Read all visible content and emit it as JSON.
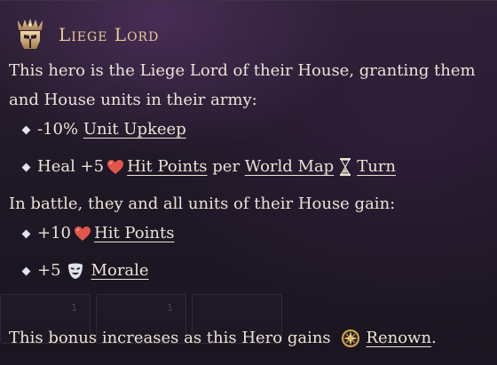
{
  "tooltip": {
    "title": "Liege Lord",
    "description_line1": "This hero is the Liege Lord of their House, granting them",
    "description_line2": "and House units in their army:",
    "bonuses_army": [
      {
        "prefix": "-10%",
        "link": "Unit Upkeep"
      },
      {
        "prefix": "Heal +5",
        "link1": "Hit Points",
        "per": "per",
        "link2": "World Map",
        "link3": "Turn"
      }
    ],
    "battle_intro": "In battle, they and all units of their House gain:",
    "bonuses_battle": [
      {
        "prefix": "+10",
        "link": "Hit Points"
      },
      {
        "prefix": "+5",
        "link": "Morale"
      }
    ],
    "footer": {
      "text": "This bonus increases as this Hero gains",
      "link": "Renown",
      "suffix": "."
    },
    "background_slots": [
      "1",
      "1"
    ]
  },
  "icons": {
    "emblem": "crowned-helm-icon",
    "hp": "heart-icon",
    "turn": "hourglass-icon",
    "morale": "mask-icon",
    "renown": "compass-star-icon"
  },
  "colors": {
    "title": "#e6c79a",
    "text": "#ece3d6",
    "heart": "#e0564a",
    "background": "#2c2033"
  }
}
